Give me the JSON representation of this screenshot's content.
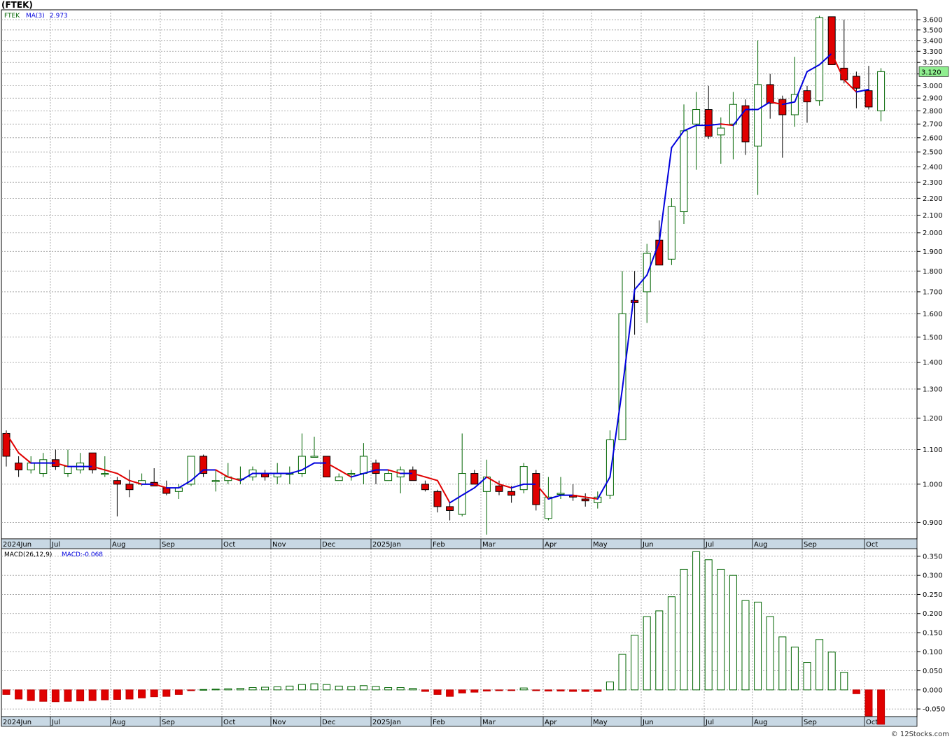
{
  "title": "(FTEK)",
  "footer": "© 12Stocks.com",
  "price_panel": {
    "symbol": "FTEK",
    "ma_label": "MA(3)",
    "ma_value": "2.973",
    "last_price": "3.120",
    "y_ticks": [
      "0.900",
      "1.000",
      "1.100",
      "1.200",
      "1.300",
      "1.400",
      "1.500",
      "1.600",
      "1.700",
      "1.800",
      "1.900",
      "2.000",
      "2.100",
      "2.200",
      "2.300",
      "2.400",
      "2.500",
      "2.600",
      "2.700",
      "2.800",
      "2.900",
      "3.000",
      "3.100",
      "3.200",
      "3.300",
      "3.400",
      "3.500",
      "3.600"
    ]
  },
  "macd_panel": {
    "label": "MACD(26,12,9)",
    "value_label": "MACD:-0.068",
    "y_ticks": [
      "-0.050",
      "0.000",
      "0.050",
      "0.100",
      "0.150",
      "0.200",
      "0.250",
      "0.300",
      "0.350"
    ]
  },
  "x_axis_labels": [
    "2024Jun",
    "Jul",
    "Aug",
    "Sep",
    "Oct",
    "Nov",
    "Dec",
    "2025Jan",
    "Feb",
    "Mar",
    "Apr",
    "May",
    "Jun",
    "Jul",
    "Aug",
    "Sep",
    "Oct"
  ],
  "colors": {
    "up": "#006400",
    "down": "#e00000",
    "ma_up": "#0000dd",
    "ma_down": "#e00000",
    "axis_bar": "#c8d8e4",
    "last_price_bg": "#90ee90"
  },
  "chart_data": [
    {
      "type": "candlestick",
      "scale": "log",
      "ylim": [
        0.86,
        3.7
      ],
      "series": [
        {
          "name": "FTEK",
          "candles": [
            [
              1.15,
              1.16,
              1.05,
              1.08
            ],
            [
              1.06,
              1.08,
              1.02,
              1.04
            ],
            [
              1.04,
              1.08,
              1.03,
              1.06
            ],
            [
              1.03,
              1.09,
              1.02,
              1.07
            ],
            [
              1.07,
              1.1,
              1.04,
              1.05
            ],
            [
              1.03,
              1.1,
              1.02,
              1.05
            ],
            [
              1.04,
              1.09,
              1.03,
              1.06
            ],
            [
              1.09,
              1.09,
              1.03,
              1.04
            ],
            [
              1.03,
              1.08,
              1.02,
              1.03
            ],
            [
              1.01,
              1.02,
              0.915,
              1.0
            ],
            [
              1.0,
              1.04,
              0.965,
              0.985
            ],
            [
              1.0,
              1.03,
              0.995,
              1.01
            ],
            [
              1.005,
              1.045,
              0.995,
              0.995
            ],
            [
              0.99,
              1.01,
              0.97,
              0.975
            ],
            [
              0.98,
              1.0,
              0.96,
              0.99
            ],
            [
              1.0,
              1.08,
              0.995,
              1.08
            ],
            [
              1.08,
              1.085,
              1.02,
              1.03
            ],
            [
              1.01,
              1.04,
              0.98,
              1.01
            ],
            [
              1.01,
              1.06,
              1.0,
              1.02
            ],
            [
              1.015,
              1.05,
              1.0,
              1.015
            ],
            [
              1.02,
              1.05,
              1.01,
              1.04
            ],
            [
              1.03,
              1.04,
              1.01,
              1.02
            ],
            [
              1.02,
              1.06,
              1.0,
              1.03
            ],
            [
              1.03,
              1.05,
              1.0,
              1.03
            ],
            [
              1.03,
              1.15,
              1.02,
              1.08
            ],
            [
              1.08,
              1.14,
              1.08,
              1.08
            ],
            [
              1.08,
              1.08,
              1.02,
              1.02
            ],
            [
              1.01,
              1.03,
              1.01,
              1.02
            ],
            [
              1.03,
              1.04,
              1.01,
              1.03
            ],
            [
              1.03,
              1.12,
              1.0,
              1.08
            ],
            [
              1.06,
              1.07,
              1.0,
              1.03
            ],
            [
              1.01,
              1.04,
              1.01,
              1.03
            ],
            [
              1.02,
              1.05,
              0.975,
              1.04
            ],
            [
              1.04,
              1.05,
              1.01,
              1.01
            ],
            [
              1.0,
              1.01,
              0.98,
              0.985
            ],
            [
              0.98,
              0.985,
              0.925,
              0.94
            ],
            [
              0.94,
              0.95,
              0.905,
              0.93
            ],
            [
              0.92,
              1.15,
              0.915,
              1.03
            ],
            [
              1.03,
              1.04,
              1.0,
              1.0
            ],
            [
              0.98,
              1.07,
              0.87,
              1.02
            ],
            [
              0.995,
              1.01,
              0.97,
              0.98
            ],
            [
              0.98,
              0.995,
              0.95,
              0.97
            ],
            [
              0.985,
              1.06,
              0.975,
              1.05
            ],
            [
              1.03,
              1.04,
              0.93,
              0.945
            ],
            [
              0.91,
              1.02,
              0.905,
              0.965
            ],
            [
              0.975,
              1.02,
              0.96,
              0.975
            ],
            [
              0.97,
              1.0,
              0.955,
              0.965
            ],
            [
              0.96,
              0.975,
              0.94,
              0.955
            ],
            [
              0.95,
              0.98,
              0.935,
              0.965
            ],
            [
              0.97,
              1.16,
              0.96,
              1.13
            ],
            [
              1.13,
              1.8,
              1.13,
              1.6
            ],
            [
              1.66,
              1.8,
              1.51,
              1.65
            ],
            [
              1.7,
              1.94,
              1.56,
              1.89
            ],
            [
              1.96,
              2.07,
              1.83,
              1.83
            ],
            [
              1.86,
              2.2,
              1.83,
              2.15
            ],
            [
              2.12,
              2.85,
              2.05,
              2.65
            ],
            [
              2.7,
              2.95,
              2.38,
              2.81
            ],
            [
              2.81,
              3.0,
              2.59,
              2.61
            ],
            [
              2.62,
              2.75,
              2.42,
              2.67
            ],
            [
              2.7,
              2.95,
              2.45,
              2.85
            ],
            [
              2.84,
              2.89,
              2.48,
              2.57
            ],
            [
              2.54,
              3.4,
              2.22,
              3.01
            ],
            [
              3.01,
              3.1,
              2.74,
              2.86
            ],
            [
              2.89,
              2.92,
              2.46,
              2.77
            ],
            [
              2.77,
              3.25,
              2.68,
              2.93
            ],
            [
              2.96,
              3.0,
              2.71,
              2.87
            ],
            [
              2.88,
              3.64,
              2.84,
              3.62
            ],
            [
              3.63,
              3.63,
              3.19,
              3.18
            ],
            [
              3.15,
              3.6,
              3.02,
              3.05
            ],
            [
              3.08,
              3.12,
              2.82,
              2.98
            ],
            [
              2.96,
              3.17,
              2.81,
              2.83
            ],
            [
              2.8,
              3.15,
              2.72,
              3.12
            ]
          ]
        },
        {
          "name": "MA(3)",
          "values": [
            1.15,
            1.09,
            1.06,
            1.06,
            1.06,
            1.05,
            1.05,
            1.05,
            1.04,
            1.03,
            1.01,
            1.0,
            1.0,
            0.99,
            0.99,
            1.01,
            1.04,
            1.04,
            1.02,
            1.01,
            1.03,
            1.03,
            1.03,
            1.03,
            1.04,
            1.06,
            1.06,
            1.04,
            1.02,
            1.03,
            1.04,
            1.04,
            1.03,
            1.03,
            1.02,
            1.01,
            0.95,
            0.97,
            0.99,
            1.02,
            1.0,
            0.99,
            1.0,
            1.0,
            0.96,
            0.97,
            0.97,
            0.965,
            0.96,
            1.02,
            1.3,
            1.71,
            1.78,
            1.95,
            2.53,
            2.65,
            2.69,
            2.69,
            2.7,
            2.69,
            2.81,
            2.81,
            2.87,
            2.85,
            2.87,
            3.12,
            3.18,
            3.28,
            3.05,
            2.95,
            2.97
          ]
        }
      ]
    },
    {
      "type": "bar",
      "name": "MACD(26,12,9)",
      "ylim": [
        -0.07,
        0.37
      ],
      "values": [
        -0.012,
        -0.024,
        -0.028,
        -0.03,
        -0.031,
        -0.03,
        -0.029,
        -0.028,
        -0.026,
        -0.025,
        -0.024,
        -0.021,
        -0.018,
        -0.017,
        -0.012,
        -0.002,
        0.001,
        0.002,
        0.003,
        0.004,
        0.006,
        0.007,
        0.008,
        0.01,
        0.014,
        0.016,
        0.014,
        0.01,
        0.009,
        0.011,
        0.009,
        0.006,
        0.006,
        0.004,
        -0.004,
        -0.012,
        -0.017,
        -0.008,
        -0.006,
        -0.003,
        -0.002,
        -0.001,
        0.005,
        -0.002,
        -0.003,
        -0.003,
        -0.004,
        -0.004,
        -0.004,
        0.021,
        0.093,
        0.143,
        0.192,
        0.207,
        0.244,
        0.316,
        0.362,
        0.341,
        0.316,
        0.3,
        0.234,
        0.23,
        0.192,
        0.139,
        0.112,
        0.072,
        0.132,
        0.099,
        0.046,
        -0.01,
        -0.068,
        -0.09
      ]
    }
  ]
}
